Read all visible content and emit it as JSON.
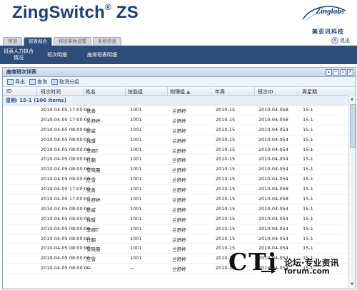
{
  "app": {
    "title": "ZingSwitch",
    "title_mark": "®",
    "title_suffix": "ZS",
    "logo_wordmark": "Zinglabs",
    "logo_cn": "美亚讯科技",
    "logout_label": "退出"
  },
  "tabs": [
    {
      "label": "预测",
      "active": false
    },
    {
      "label": "班表拟合",
      "active": true
    },
    {
      "label": "排班参数设置",
      "active": false
    },
    {
      "label": "系统信息",
      "active": false
    }
  ],
  "subnav": [
    {
      "label": "班表人力拟合情况"
    },
    {
      "label": "班次明细"
    },
    {
      "label": "座席班表明细"
    }
  ],
  "panel": {
    "title": "座席班次详表",
    "window_buttons": [
      "▴",
      "−",
      "▫",
      "×"
    ]
  },
  "toolbar": {
    "export_label": "导出",
    "query_label": "查询",
    "ungroup_label": "取消分组"
  },
  "table": {
    "columns": [
      "ID",
      "班次时间",
      "姓名",
      "技能组",
      "物理组",
      "年周",
      "班次ID",
      "周星期"
    ],
    "sorted_indicator": "▲",
    "group_label": "星期: 15-1 (106 Items)",
    "rows": [
      [
        "2010-04-05 17:00:00",
        "张善",
        "1001",
        "兰舒婷",
        "2010-15",
        "2010-04-058",
        "15-1"
      ],
      [
        "2010-04-05 17:00:00",
        "兰舒婷",
        "1001",
        "兰舒婷",
        "2010-15",
        "2010-04-058",
        "15-1"
      ],
      [
        "2010-04-05 08:00:00",
        "彭威",
        "1001",
        "兰舒婷",
        "2010-15",
        "2010-04-054",
        "15-1"
      ],
      [
        "2010-04-05 08:00:00",
        "谷盟",
        "1001",
        "兰舒婷",
        "2010-15",
        "2010-04-054",
        "15-1"
      ],
      [
        "2010-04-05 08:00:00",
        "李卿T",
        "1001",
        "兰舒婷",
        "2010-15",
        "2010-04-054",
        "15-1"
      ],
      [
        "2010-04-05 08:00:00",
        "任朝",
        "1001",
        "兰舒婷",
        "2010-15",
        "2010-04-054",
        "15-1"
      ],
      [
        "2010-04-05 08:00:00",
        "安晓晨",
        "1001",
        "兰舒婷",
        "2010-15",
        "2010-04-054",
        "15-1"
      ],
      [
        "2010-04-05 08:00:00",
        "庄雪",
        "1001",
        "兰舒婷",
        "2010-15",
        "2010-04-054",
        "15-1"
      ],
      [
        "2010-04-05 17:00:00",
        "张善",
        "1001",
        "兰舒婷",
        "2010-15",
        "2010-04-058",
        "15-1"
      ],
      [
        "2010-04-05 17:00:00",
        "兰舒婷",
        "1001",
        "兰舒婷",
        "2010-15",
        "2010-04-058",
        "15-1"
      ],
      [
        "2010-04-05 08:00:00",
        "彭威",
        "1001",
        "兰舒婷",
        "2010-15",
        "2010-04-054",
        "15-1"
      ],
      [
        "2010-04-05 08:00:00",
        "谷盟",
        "1001",
        "兰舒婷",
        "2010-15",
        "2010-04-054",
        "15-1"
      ],
      [
        "2010-04-05 08:00:00",
        "李卿T",
        "1001",
        "兰舒婷",
        "2010-15",
        "2010-04-054",
        "15-1"
      ],
      [
        "2010-04-05 08:00:00",
        "任朝",
        "1001",
        "兰舒婷",
        "2010-15",
        "2010-04-054",
        "15-1"
      ],
      [
        "2010-04-05 08:00:00",
        "安晓晨",
        "1001",
        "兰舒婷",
        "2010-15",
        "2010-04-054",
        "15-1"
      ],
      [
        "2010-04-05 08:00:00",
        "庄雪",
        "1001",
        "兰舒婷",
        "2010-15",
        "2010-04-054",
        "15-1"
      ],
      [
        "2010-04-05 08:00:00",
        "—",
        "—",
        "兰舒婷",
        "2010-15",
        "2010-04-054",
        "15-1"
      ]
    ]
  },
  "watermark": {
    "brand": "CTi",
    "cn": "论坛·专业资讯",
    "url": "forum.com"
  },
  "colors": {
    "brand_navy": "#1b3f79",
    "subnav_bg": "#2f4d7a",
    "group_text": "#2a5798"
  }
}
